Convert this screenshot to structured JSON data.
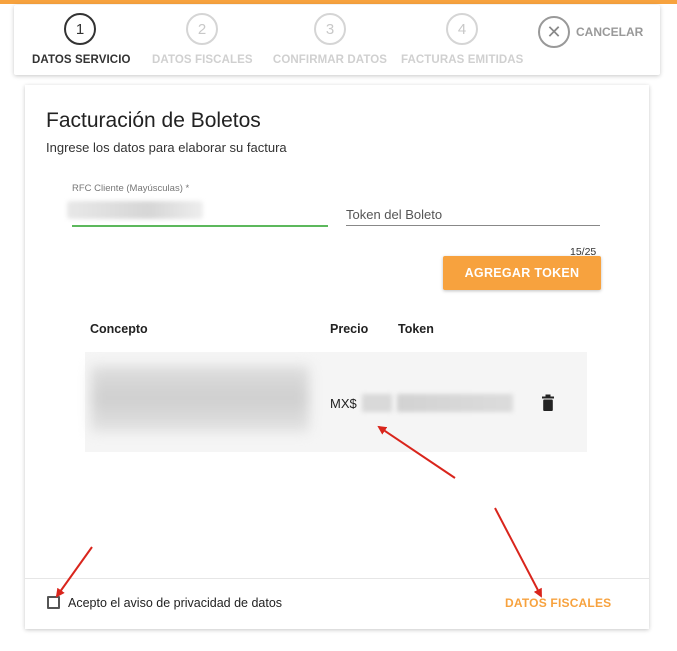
{
  "stepper": {
    "steps": [
      {
        "number": "1",
        "label": "DATOS SERVICIO",
        "state": "active"
      },
      {
        "number": "2",
        "label": "DATOS FISCALES",
        "state": "inactive"
      },
      {
        "number": "3",
        "label": "CONFIRMAR DATOS",
        "state": "inactive"
      },
      {
        "number": "4",
        "label": "FACTURAS EMITIDAS",
        "state": "inactive"
      }
    ],
    "cancel_label": "CANCELAR",
    "cancel_icon": "close-icon"
  },
  "form": {
    "title": "Facturación de Boletos",
    "subtitle": "Ingrese los datos para elaborar su factura",
    "rfc_label": "RFC Cliente (Mayúsculas) *",
    "token_placeholder": "Token del Boleto",
    "token_counter": "15/25",
    "add_button": "AGREGAR TOKEN"
  },
  "table": {
    "headers": [
      "Concepto",
      "Precio",
      "Token"
    ],
    "rows": [
      {
        "price_prefix": "MX$",
        "delete_icon": "trash-icon"
      }
    ]
  },
  "footer": {
    "privacy_label": "Acepto el aviso de privacidad de datos",
    "privacy_checked": false,
    "next_button": "DATOS FISCALES"
  },
  "colors": {
    "accent": "#f7a23e",
    "focus_line": "#5cb85c",
    "annotation_arrow": "#d9251c"
  }
}
